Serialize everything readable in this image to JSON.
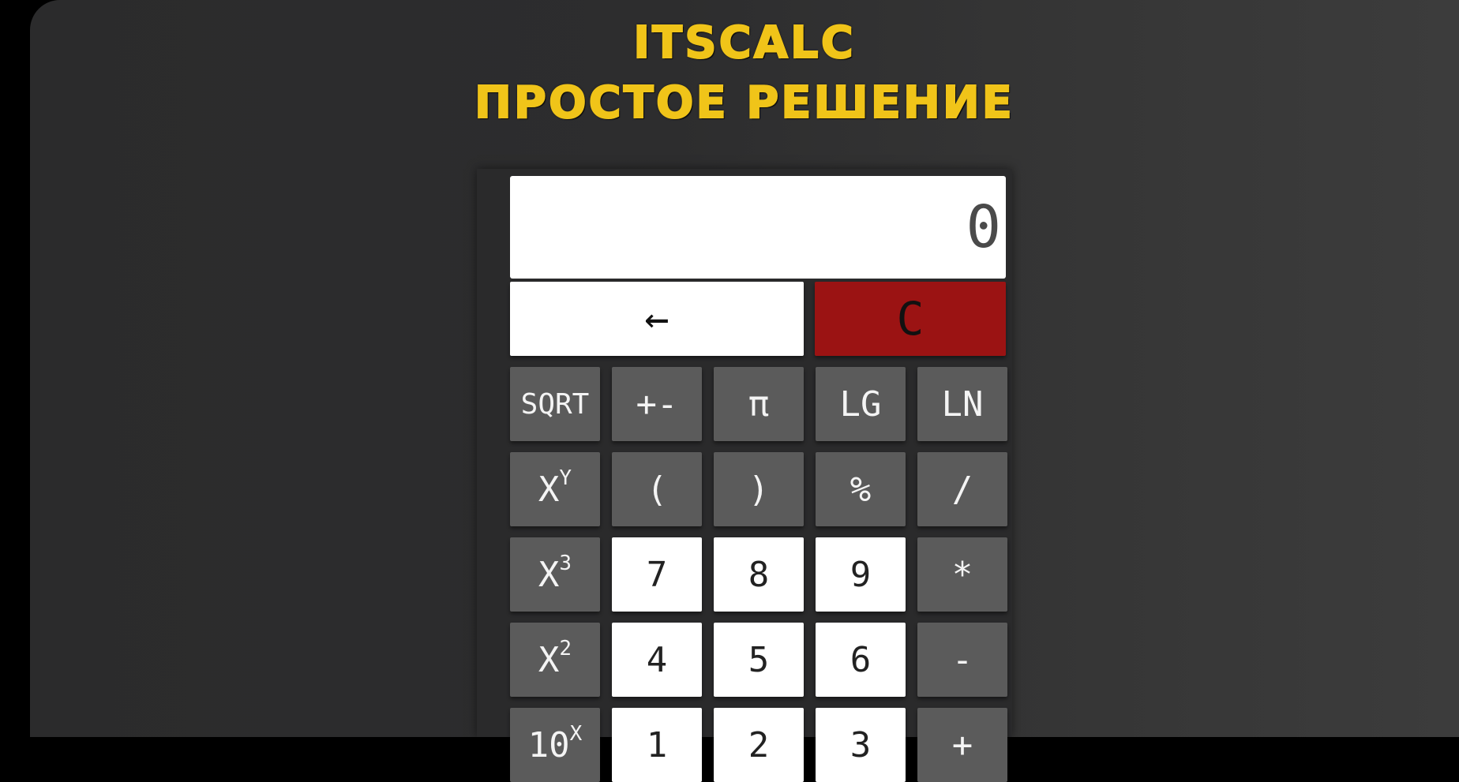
{
  "header": {
    "title": "ITSCALC",
    "subtitle": "ПРОСТОЕ РЕШЕНИЕ"
  },
  "display": {
    "value": "0"
  },
  "controls": {
    "backspace": "←",
    "clear": "C"
  },
  "rows": [
    [
      {
        "label": "SQRT",
        "style": "gray",
        "name": "sqrt-button"
      },
      {
        "label": "+-",
        "style": "gray",
        "name": "sign-toggle-button"
      },
      {
        "label": "π",
        "style": "gray",
        "name": "pi-button"
      },
      {
        "label": "LG",
        "style": "gray",
        "name": "lg-button"
      },
      {
        "label": "LN",
        "style": "gray",
        "name": "ln-button"
      }
    ],
    [
      {
        "label": "X",
        "sup": "Y",
        "style": "gray",
        "name": "power-xy-button"
      },
      {
        "label": "(",
        "style": "gray",
        "name": "open-paren-button"
      },
      {
        "label": ")",
        "style": "gray",
        "name": "close-paren-button"
      },
      {
        "label": "%",
        "style": "gray",
        "name": "percent-button"
      },
      {
        "label": "/",
        "style": "gray",
        "name": "divide-button"
      }
    ],
    [
      {
        "label": "X",
        "sup": "3",
        "style": "gray",
        "name": "cube-button"
      },
      {
        "label": "7",
        "style": "white",
        "name": "digit-7-button"
      },
      {
        "label": "8",
        "style": "white",
        "name": "digit-8-button"
      },
      {
        "label": "9",
        "style": "white",
        "name": "digit-9-button"
      },
      {
        "label": "*",
        "style": "gray",
        "name": "multiply-button"
      }
    ],
    [
      {
        "label": "X",
        "sup": "2",
        "style": "gray",
        "name": "square-button"
      },
      {
        "label": "4",
        "style": "white",
        "name": "digit-4-button"
      },
      {
        "label": "5",
        "style": "white",
        "name": "digit-5-button"
      },
      {
        "label": "6",
        "style": "white",
        "name": "digit-6-button"
      },
      {
        "label": "-",
        "style": "gray",
        "name": "minus-button"
      }
    ],
    [
      {
        "label": "10",
        "sup": "X",
        "style": "gray",
        "name": "ten-power-button"
      },
      {
        "label": "1",
        "style": "white",
        "name": "digit-1-button"
      },
      {
        "label": "2",
        "style": "white",
        "name": "digit-2-button"
      },
      {
        "label": "3",
        "style": "white",
        "name": "digit-3-button"
      },
      {
        "label": "+",
        "style": "gray",
        "name": "plus-button"
      }
    ]
  ]
}
